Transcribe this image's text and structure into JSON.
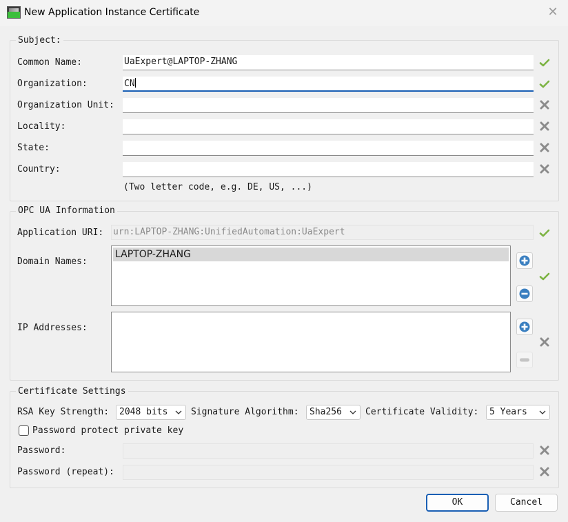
{
  "window": {
    "title": "New Application Instance Certificate",
    "close_glyph": "✕"
  },
  "subject": {
    "title": "Subject:",
    "fields": [
      {
        "label": "Common Name:",
        "value": "UaExpert@LAPTOP-ZHANG",
        "status": "check-icon"
      },
      {
        "label": "Organization:",
        "value": "CN",
        "status": "check-icon"
      },
      {
        "label": "Organization Unit:",
        "value": "",
        "status": "x-icon"
      },
      {
        "label": "Locality:",
        "value": "",
        "status": "x-icon"
      },
      {
        "label": "State:",
        "value": "",
        "status": "x-icon"
      },
      {
        "label": "Country:",
        "value": "",
        "status": "x-icon"
      }
    ],
    "country_hint": "(Two letter code, e.g. DE, US, ...)"
  },
  "opcua": {
    "title": "OPC UA Information",
    "app_uri_label": "Application URI:",
    "app_uri_value": "urn:LAPTOP-ZHANG:UnifiedAutomation:UaExpert",
    "domain_names_label": "Domain Names:",
    "domain_names": [
      "LAPTOP-ZHANG"
    ],
    "ip_addresses_label": "IP Addresses:",
    "ip_addresses": []
  },
  "cert": {
    "title": "Certificate Settings",
    "rsa_label": "RSA Key Strength:",
    "rsa_value": "2048 bits",
    "sig_label": "Signature Algorithm:",
    "sig_value": "Sha256",
    "validity_label": "Certificate Validity:",
    "validity_value": "5 Years",
    "protect_label": "Password protect private key",
    "protect_checked": false,
    "password_label": "Password:",
    "password_repeat_label": "Password (repeat):"
  },
  "buttons": {
    "ok": "OK",
    "cancel": "Cancel"
  },
  "colors": {
    "accent": "#1a5fb4",
    "ok_check": "#7cb342",
    "x_gray": "#8c8c8c",
    "plus_blue": "#3a7fc0"
  }
}
